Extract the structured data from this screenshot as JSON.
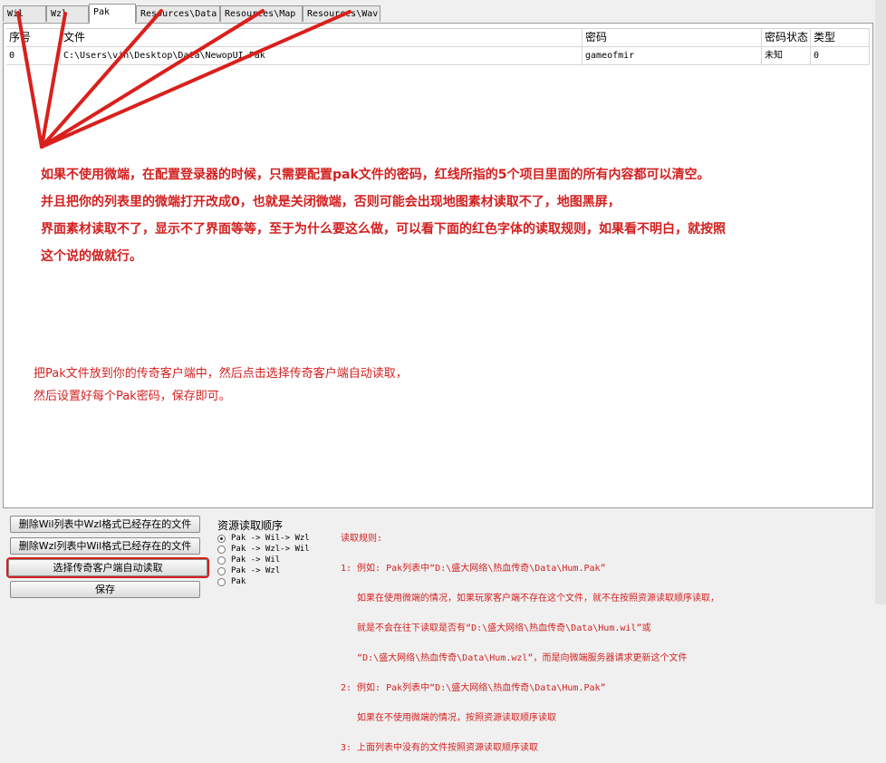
{
  "tabs": [
    "Wil",
    "Wzl",
    "Pak",
    "Resources\\Data",
    "Resources\\Map",
    "Resources\\Wav"
  ],
  "active_tab": "Pak",
  "table": {
    "headers": [
      "序号",
      "文件",
      "密码",
      "密码状态",
      "类型"
    ],
    "rows": [
      [
        "0",
        "C:\\Users\\vin\\Desktop\\Data\\NewopUI.Pak",
        "gameofmir",
        "未知",
        "0"
      ]
    ]
  },
  "annotation": {
    "color": "#d31f1f",
    "lines": [
      "如果不使用微端，在配置登录器的时候，只需要配置pak文件的密码，红线所指的5个项目里面的所有内容都可以清空。",
      "并且把你的列表里的微端打开改成0，也就是关闭微端，否则可能会出现地图素材读取不了，地图黑屏，",
      "界面素材读取不了，显示不了界面等等，至于为什么要这么做，可以看下面的红色字体的读取规则，如果看不明白，就按照",
      "这个说的做就行。"
    ],
    "hint_lines": [
      "把Pak文件放到你的传奇客户端中，然后点击选择传奇客户端自动读取，",
      "然后设置好每个Pak密码，保存即可。"
    ]
  },
  "buttons": {
    "delete_wil": "删除Wil列表中Wzl格式已经存在的文件",
    "delete_wzl": "删除Wzl列表中Wil格式已经存在的文件",
    "auto_read": "选择传奇客户端自动读取",
    "save": "保存"
  },
  "read_order": {
    "title": "资源读取顺序",
    "options": [
      "Pak -> Wil-> Wzl",
      "Pak -> Wzl-> Wil",
      "Pak -> Wil",
      "Pak -> Wzl",
      "Pak"
    ],
    "selected": 0
  },
  "rules": {
    "title": "读取规则:",
    "lines": [
      "1: 例如: Pak列表中“D:\\盛大网络\\热血传奇\\Data\\Hum.Pak”",
      "   如果在使用微端的情况，如果玩家客户端不存在这个文件，就不在按照资源读取顺序读取，",
      "   就是不会在往下读取是否有“D:\\盛大网络\\热血传奇\\Data\\Hum.wil”或",
      "   “D:\\盛大网络\\热血传奇\\Data\\Hum.wzl”，而是向微端服务器请求更新这个文件",
      "2: 例如: Pak列表中“D:\\盛大网络\\热血传奇\\Data\\Hum.Pak”",
      "   如果在不使用微端的情况，按照资源读取顺序读取",
      "3: 上面列表中没有的文件按照资源读取顺序读取"
    ]
  }
}
